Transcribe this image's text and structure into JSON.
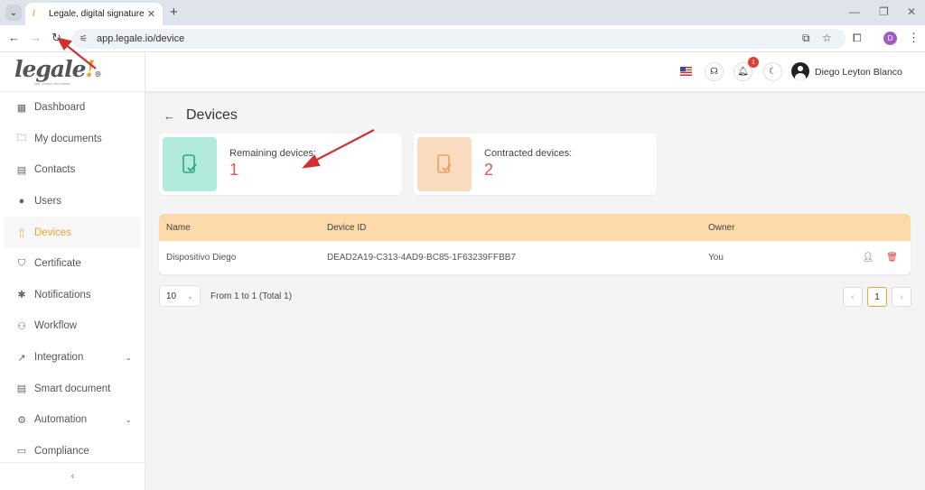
{
  "browser": {
    "tab_title": "Legale, digital signature",
    "url": "app.legale.io/device",
    "profile_initial": "D"
  },
  "app": {
    "logo_text": "legale",
    "logo_mark": "!",
    "logo_registered": "®",
    "logo_tagline": "fast, secure and smart",
    "user_name": "Diego Leyton Blanco",
    "notification_count": "1"
  },
  "sidebar": {
    "items": [
      {
        "label": "Dashboard",
        "icon": "dashboard-icon",
        "glyph": "▦"
      },
      {
        "label": "My documents",
        "icon": "folder-icon",
        "glyph": "🗀"
      },
      {
        "label": "Contacts",
        "icon": "contacts-icon",
        "glyph": "▤"
      },
      {
        "label": "Users",
        "icon": "user-icon",
        "glyph": "●"
      },
      {
        "label": "Devices",
        "icon": "device-icon",
        "glyph": "▯"
      },
      {
        "label": "Certificate",
        "icon": "shield-icon",
        "glyph": "⛉"
      },
      {
        "label": "Notifications",
        "icon": "bell-icon",
        "glyph": "✱"
      },
      {
        "label": "Workflow",
        "icon": "workflow-icon",
        "glyph": "⚇"
      },
      {
        "label": "Integration",
        "icon": "external-link-icon",
        "glyph": "↗"
      },
      {
        "label": "Smart document",
        "icon": "smart-document-icon",
        "glyph": "▤"
      },
      {
        "label": "Automation",
        "icon": "automation-icon",
        "glyph": "⚙"
      },
      {
        "label": "Compliance",
        "icon": "compliance-icon",
        "glyph": "▭"
      }
    ],
    "active": "Devices",
    "collapse_glyph": "‹"
  },
  "page": {
    "title": "Devices",
    "stats": [
      {
        "label": "Remaining devices:",
        "value": "1",
        "tile_color": "#b2eadc",
        "icon_color": "#2fa787"
      },
      {
        "label": "Contracted devices:",
        "value": "2",
        "tile_color": "#f9dcc0",
        "icon_color": "#e8a15a"
      }
    ],
    "table": {
      "columns": [
        "Name",
        "Device ID",
        "Owner"
      ],
      "rows": [
        {
          "name": "Dispositivo Diego",
          "device_id": "DEAD2A19-C313-4AD9-BC85-1F63239FFBB7",
          "owner": "You"
        }
      ]
    },
    "pagination": {
      "page_size": "10",
      "info": "From 1 to 1 (Total 1)",
      "current_page": "1"
    }
  },
  "colors": {
    "accent": "#f0a030",
    "header_row": "#fcd9a8",
    "value_red": "#e05a4f",
    "arrow_red": "#d32f2f"
  }
}
